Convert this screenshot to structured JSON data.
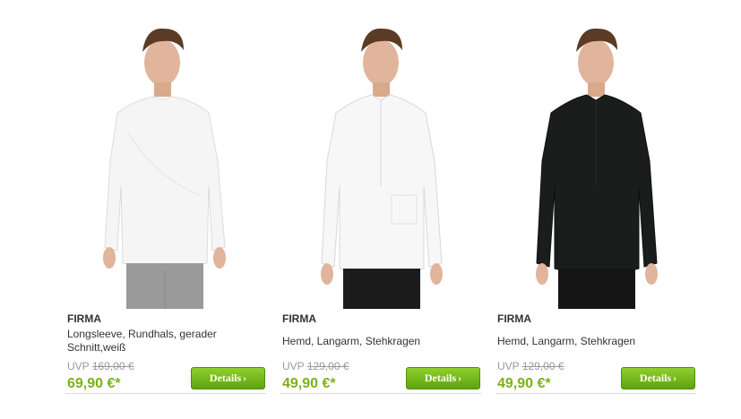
{
  "products": [
    {
      "brand": "FIRMA",
      "name": "Longsleeve, Rundhals, gerader Schnitt,weiß",
      "uvp_label": "UVP",
      "uvp_old": "169,00 €",
      "price": "69,90 €*",
      "details_label": "Details",
      "chevron": "›",
      "shirt_color": "#f5f5f5",
      "pants_color": "#9a9a9a"
    },
    {
      "brand": "FIRMA",
      "name": "Hemd, Langarm, Stehkragen",
      "uvp_label": "UVP",
      "uvp_old": "129,00 €",
      "price": "49,90 €*",
      "details_label": "Details",
      "chevron": "›",
      "shirt_color": "#f7f7f7",
      "pants_color": "#1c1c1c"
    },
    {
      "brand": "FIRMA",
      "name": "Hemd, Langarm, Stehkragen",
      "uvp_label": "UVP",
      "uvp_old": "129,00 €",
      "price": "49,90 €*",
      "details_label": "Details",
      "chevron": "›",
      "shirt_color": "#1b1d1d",
      "pants_color": "#151515"
    }
  ],
  "colors": {
    "price_green": "#7ab317",
    "button_green": "#6cb21a",
    "uvp_gray": "#999999",
    "skin": "#e0b59c",
    "hair": "#5a3b26"
  }
}
